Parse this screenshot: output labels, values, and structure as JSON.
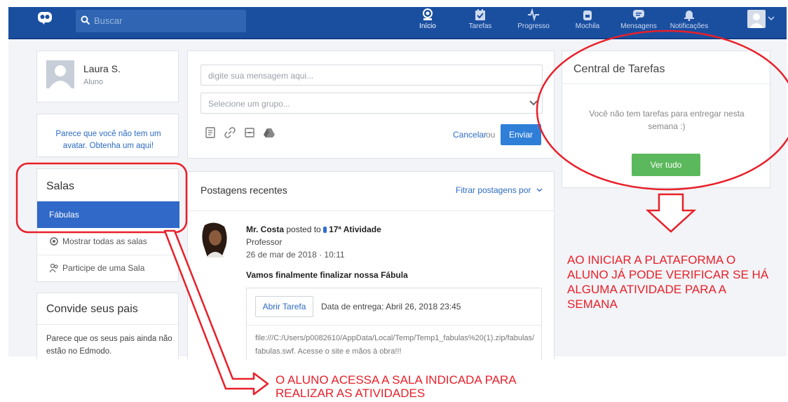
{
  "topbar": {
    "search_placeholder": "Buscar",
    "nav": [
      {
        "label": "Início",
        "icon": "home-icon",
        "active": true
      },
      {
        "label": "Tarefas",
        "icon": "tasks-icon",
        "active": false
      },
      {
        "label": "Progresso",
        "icon": "progress-icon",
        "active": false
      },
      {
        "label": "Mochila",
        "icon": "backpack-icon",
        "active": false
      },
      {
        "label": "Mensagens",
        "icon": "messages-icon",
        "active": false
      },
      {
        "label": "Notificações",
        "icon": "bell-icon",
        "active": false
      }
    ],
    "colors": {
      "bar": "#1a4fa0",
      "search": "#2f65b3"
    }
  },
  "profile": {
    "name": "Laura S.",
    "role": "Aluno"
  },
  "avatar_note": "Parece que você não tem um avatar. Obtenha um aqui!",
  "salas": {
    "title": "Salas",
    "rooms": [
      {
        "label": "Fábulas",
        "active": true
      }
    ],
    "show_all": "Mostrar todas as salas",
    "join": "Participe de uma Sala"
  },
  "convide": {
    "title": "Convide seus pais",
    "text": "Parece que os seus pais ainda não estão no Edmodo."
  },
  "composer": {
    "message_placeholder": "digite sua mensagem aqui...",
    "group_placeholder": "Selecione um grupo...",
    "cancel": "Cancelar",
    "or": "ou",
    "send": "Enviar"
  },
  "posts": {
    "title": "Postagens recentes",
    "filter": "Fitrar postagens por",
    "items": [
      {
        "author": "Mr. Costa",
        "posted_to": "posted to",
        "group": "17ª Atividade",
        "role": "Professor",
        "date": "26 de mar de 2018 · 10:11",
        "title": "Vamos finalmente finalizar nossa Fábula",
        "open_task": "Abrir Tarefa",
        "due": "Data de entrega: Abril 26, 2018 23:45",
        "body": "file:///C:/Users/p0082610/AppData/Local/Temp/Temp1_fabulas%20(1).zip/fabulas/fabulas.swf. Acesse o site e mãos à obra!!!"
      }
    ]
  },
  "central": {
    "title": "Central de Tarefas",
    "empty": "Você não tem tarefas para entregar nesta semana :)",
    "see_all": "Ver tudo"
  },
  "annotations": {
    "right": "AO INICIAR A PLATAFORMA O ALUNO JÁ PODE VERIFICAR SE HÁ ALGUMA ATIVIDADE PARA A SEMANA",
    "bottom": "O ALUNO ACESSA A SALA INDICADA PARA REALIZAR AS ATIVIDADES",
    "color": "#e8202a"
  }
}
